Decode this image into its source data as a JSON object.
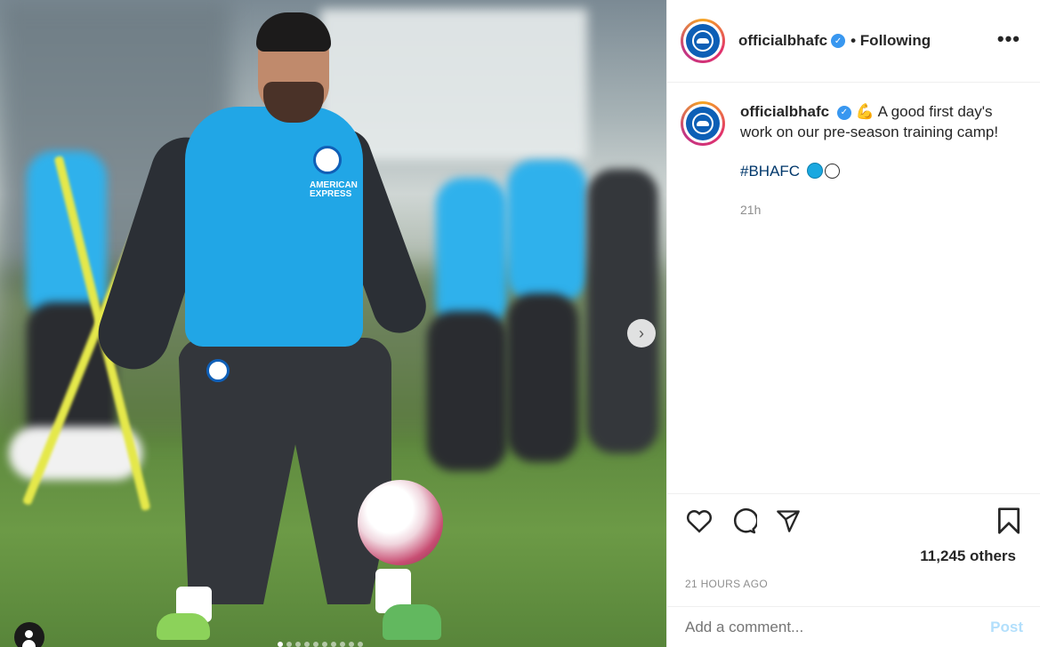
{
  "post": {
    "username": "officialbhafc",
    "follow_status": "• Following",
    "more_label": "•••",
    "caption": {
      "username": "officialbhafc",
      "emoji": "💪",
      "text": "A good first day's work on our pre-season training camp!",
      "hashtag": "#BHAFC",
      "time": "21h"
    },
    "photo": {
      "sponsor_text": "AMERICAN EXPRESS",
      "next_arrow": "›",
      "carousel_count": 10,
      "carousel_active": 0
    },
    "actions": {
      "like_icon": "heart-icon",
      "comment_icon": "comment-icon",
      "share_icon": "share-icon",
      "save_icon": "bookmark-icon"
    },
    "likes": "11,245 others",
    "timestamp": "21 HOURS AGO",
    "comment_placeholder": "Add a comment...",
    "post_label": "Post"
  },
  "colors": {
    "verified_blue": "#3897f0",
    "brighton_blue": "#0d5fb6",
    "post_disabled": "#b2dffc",
    "hashtag": "#00376b"
  }
}
